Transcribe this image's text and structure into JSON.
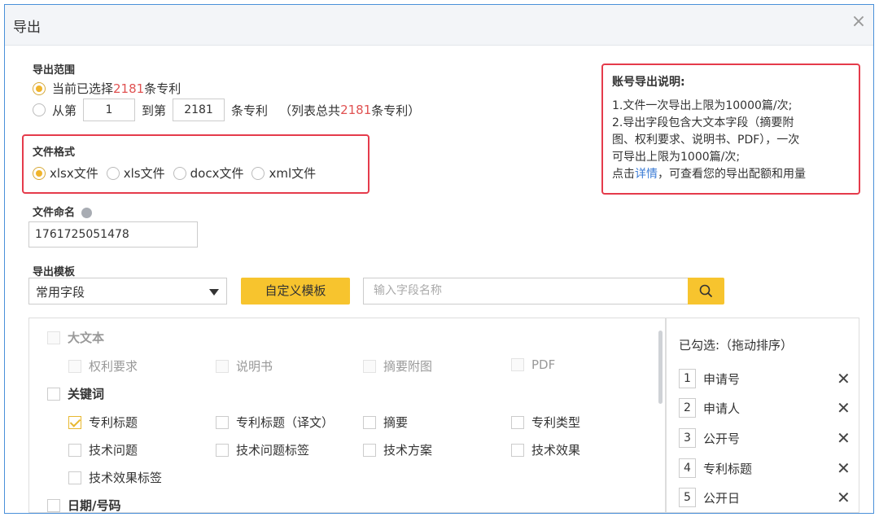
{
  "dialog": {
    "title": "导出"
  },
  "range": {
    "label": "导出范围",
    "current_prefix": "当前已选择 ",
    "current_count": "2181",
    "current_suffix": "条专利",
    "from_prefix": "从第",
    "from_value": "1",
    "to_prefix": "到第",
    "to_value": "2181",
    "to_suffix": "条专利",
    "total_prefix": "（列表总共",
    "total_count": "2181",
    "total_suffix": "条专利）"
  },
  "format": {
    "label": "文件格式",
    "options": [
      "xlsx文件",
      "xls文件",
      "docx文件",
      "xml文件"
    ],
    "selected": "xlsx文件"
  },
  "filename": {
    "label": "文件命名",
    "value": "1761725051478"
  },
  "template": {
    "label": "导出模板",
    "select_value": "常用字段",
    "custom_button": "自定义模板",
    "search_placeholder": "输入字段名称"
  },
  "info": {
    "title": "账号导出说明:",
    "line1": "1.文件一次导出上限为10000篇/次;",
    "line2": "2.导出字段包含大文本字段（摘要附",
    "line3": "图、权利要求、说明书、PDF），一次",
    "line4": "可导出上限为1000篇/次;",
    "line5_prefix": "点击",
    "line5_link": "详情",
    "line5_suffix": "，可查看您的导出配额和用量"
  },
  "fields": {
    "big_text": {
      "label": "大文本",
      "items": [
        "权利要求",
        "说明书",
        "摘要附图",
        "PDF"
      ]
    },
    "keywords": {
      "label": "关键词",
      "items": [
        "专利标题",
        "专利标题（译文）",
        "摘要",
        "专利类型",
        "技术问题",
        "技术问题标签",
        "技术方案",
        "技术效果",
        "技术效果标签"
      ],
      "checked": [
        "专利标题"
      ]
    },
    "date_number": {
      "label": "日期/号码"
    }
  },
  "selected": {
    "title": "已勾选:（拖动排序）",
    "items": [
      {
        "num": "1",
        "label": "申请号"
      },
      {
        "num": "2",
        "label": "申请人"
      },
      {
        "num": "3",
        "label": "公开号"
      },
      {
        "num": "4",
        "label": "专利标题"
      },
      {
        "num": "5",
        "label": "公开日"
      }
    ]
  },
  "colors": {
    "accent": "#f7c42e",
    "highlight_box": "#e53b4b",
    "link": "#3a7bd5",
    "count_red": "#e05252"
  }
}
